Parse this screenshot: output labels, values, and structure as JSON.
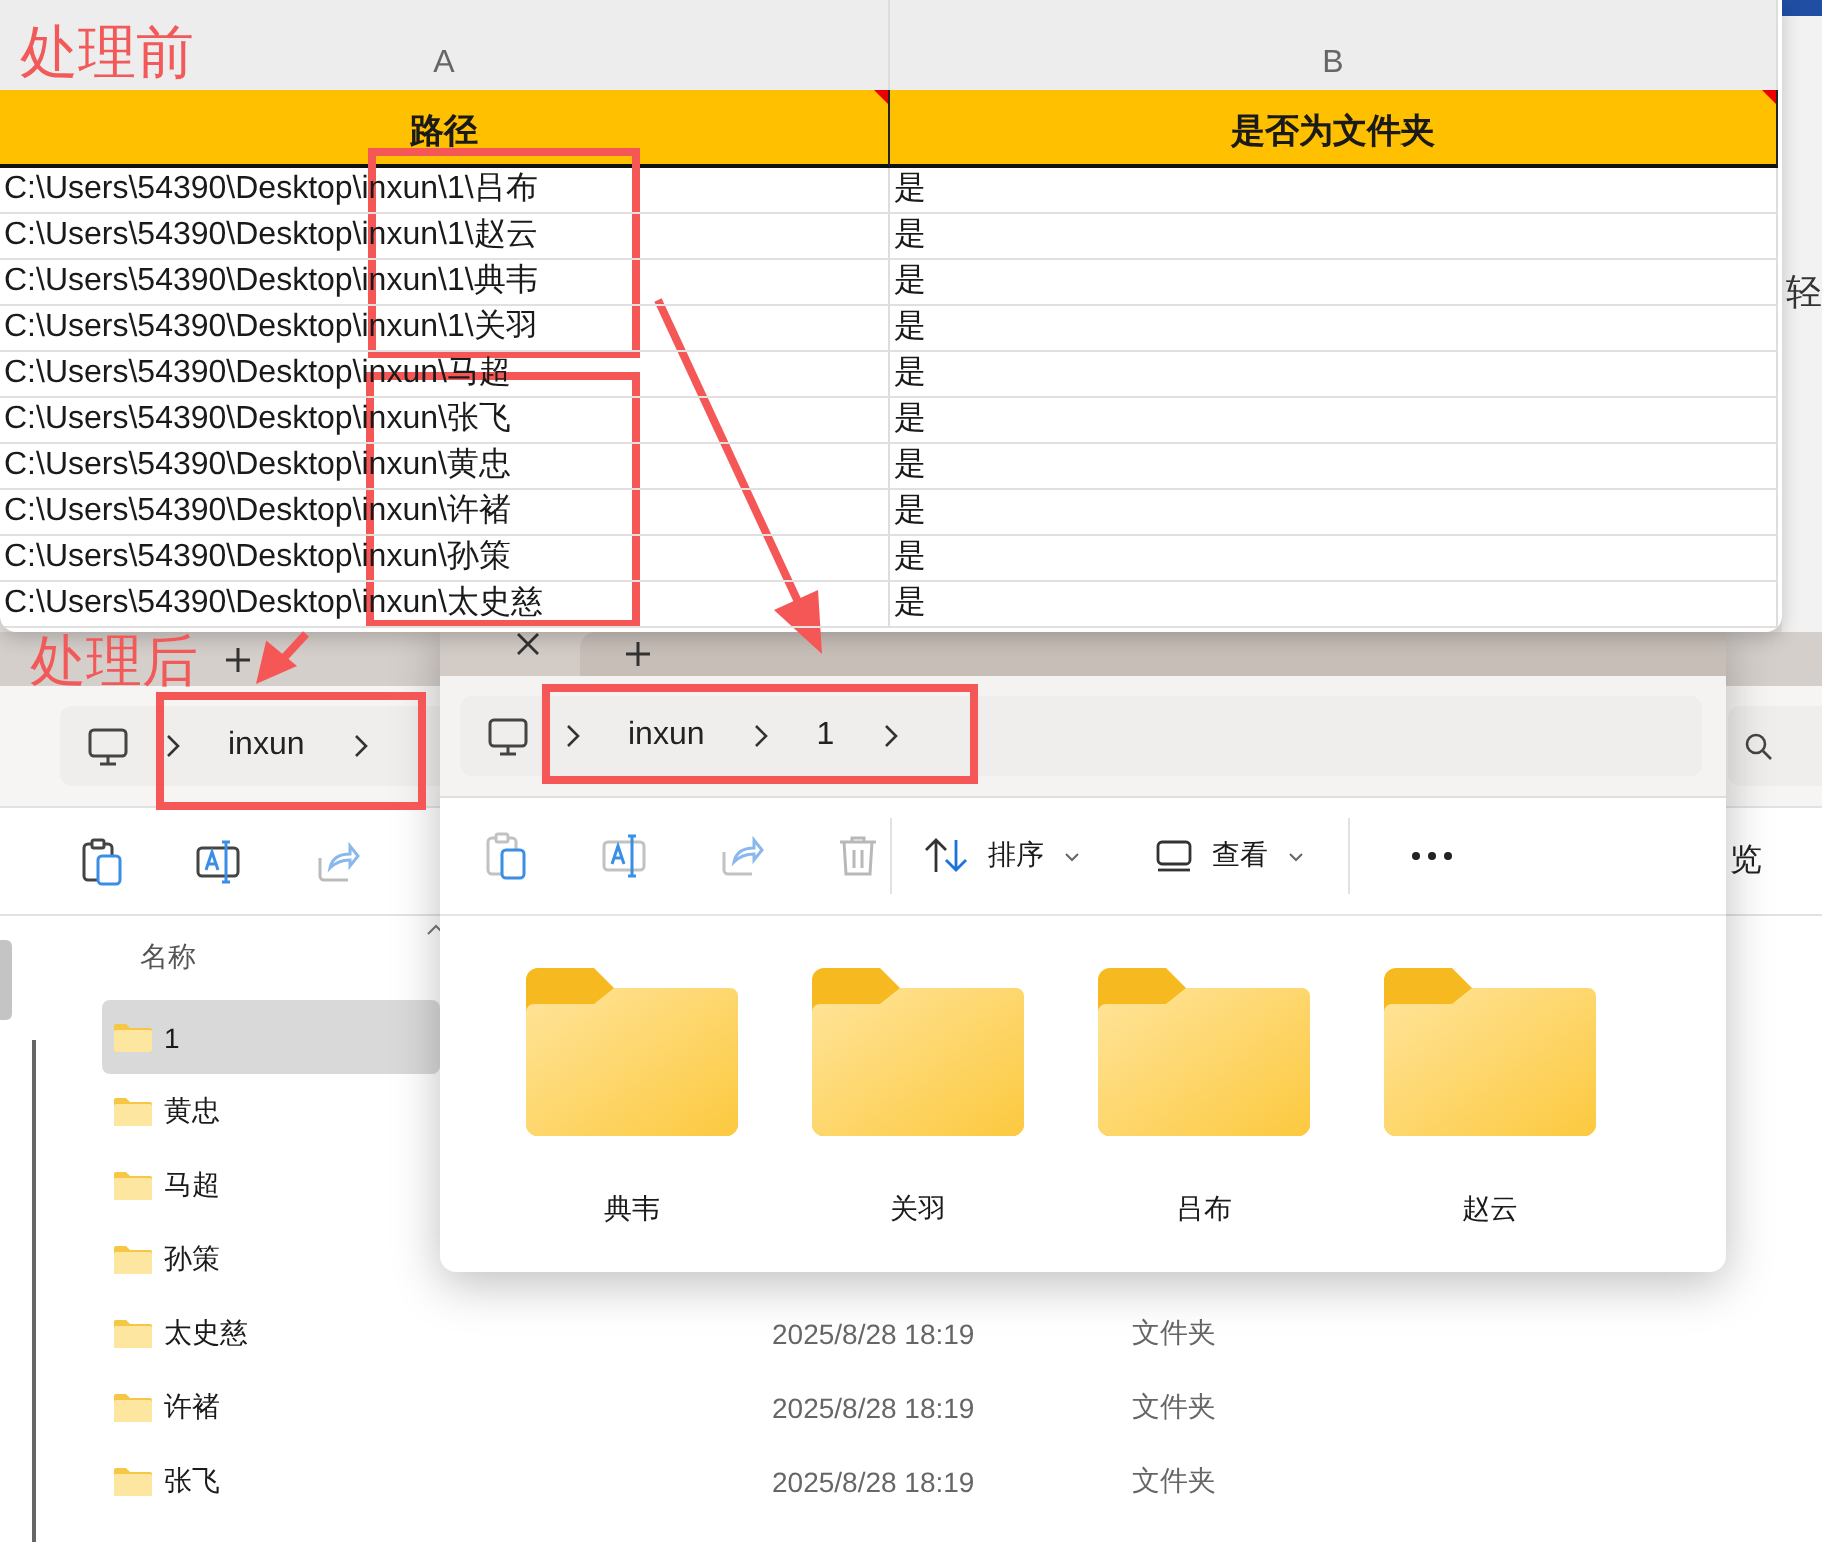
{
  "annotations": {
    "before_label": "处理前",
    "after_label": "处理后"
  },
  "spreadsheet": {
    "column_letters": [
      "A",
      "B"
    ],
    "headers": [
      "路径",
      "是否为文件夹"
    ],
    "rows": [
      {
        "path": "C:\\Users\\54390\\Desktop\\inxun\\1\\吕布",
        "is_folder": "是"
      },
      {
        "path": "C:\\Users\\54390\\Desktop\\inxun\\1\\赵云",
        "is_folder": "是"
      },
      {
        "path": "C:\\Users\\54390\\Desktop\\inxun\\1\\典韦",
        "is_folder": "是"
      },
      {
        "path": "C:\\Users\\54390\\Desktop\\inxun\\1\\关羽",
        "is_folder": "是"
      },
      {
        "path": "C:\\Users\\54390\\Desktop\\inxun\\马超",
        "is_folder": "是"
      },
      {
        "path": "C:\\Users\\54390\\Desktop\\inxun\\张飞",
        "is_folder": "是"
      },
      {
        "path": "C:\\Users\\54390\\Desktop\\inxun\\黄忠",
        "is_folder": "是"
      },
      {
        "path": "C:\\Users\\54390\\Desktop\\inxun\\许褚",
        "is_folder": "是"
      },
      {
        "path": "C:\\Users\\54390\\Desktop\\inxun\\孙策",
        "is_folder": "是"
      },
      {
        "path": "C:\\Users\\54390\\Desktop\\inxun\\太史慈",
        "is_folder": "是"
      }
    ]
  },
  "background_window": {
    "partial_text": "轻"
  },
  "back_explorer": {
    "breadcrumb": [
      "inxun"
    ],
    "toolbar_partial_label": "览",
    "column_header": "名称",
    "items": [
      {
        "name": "1",
        "selected": true
      },
      {
        "name": "黄忠",
        "selected": false
      },
      {
        "name": "马超",
        "selected": false
      },
      {
        "name": "孙策",
        "selected": false
      },
      {
        "name": "太史慈",
        "selected": false,
        "modified": "2025/8/28 18:19",
        "type": "文件夹"
      },
      {
        "name": "许褚",
        "selected": false,
        "modified": "2025/8/28 18:19",
        "type": "文件夹"
      },
      {
        "name": "张飞",
        "selected": false,
        "modified": "2025/8/28 18:19",
        "type": "文件夹"
      }
    ]
  },
  "front_explorer": {
    "breadcrumb": [
      "inxun",
      "1"
    ],
    "toolbar": [
      {
        "kind": "sort",
        "label": "排序"
      },
      {
        "kind": "view",
        "label": "查看"
      }
    ],
    "folders": [
      "典韦",
      "关羽",
      "吕布",
      "赵云"
    ]
  }
}
